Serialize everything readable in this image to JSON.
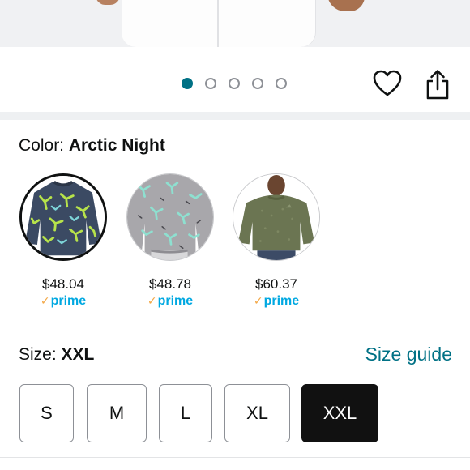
{
  "product_image": {
    "carousel": {
      "total": 5,
      "active_index": 0
    }
  },
  "actions": {
    "wishlist_icon": "heart-icon",
    "share_icon": "share-icon"
  },
  "color": {
    "label": "Color: ",
    "selected": "Arctic Night",
    "options": [
      {
        "price": "$48.04",
        "badge": "prime",
        "badge_check": "✓",
        "selected": true
      },
      {
        "price": "$48.78",
        "badge": "prime",
        "badge_check": "✓",
        "selected": false
      },
      {
        "price": "$60.37",
        "badge": "prime",
        "badge_check": "✓",
        "selected": false
      }
    ]
  },
  "size": {
    "label": "Size: ",
    "selected": "XXL",
    "guide_label": "Size guide",
    "options": [
      "S",
      "M",
      "L",
      "XL",
      "XXL"
    ]
  },
  "colors": {
    "accent": "#007185",
    "prime_blue": "#00a8e1",
    "prime_check": "#f3a847",
    "selected_size_bg": "#111111"
  }
}
